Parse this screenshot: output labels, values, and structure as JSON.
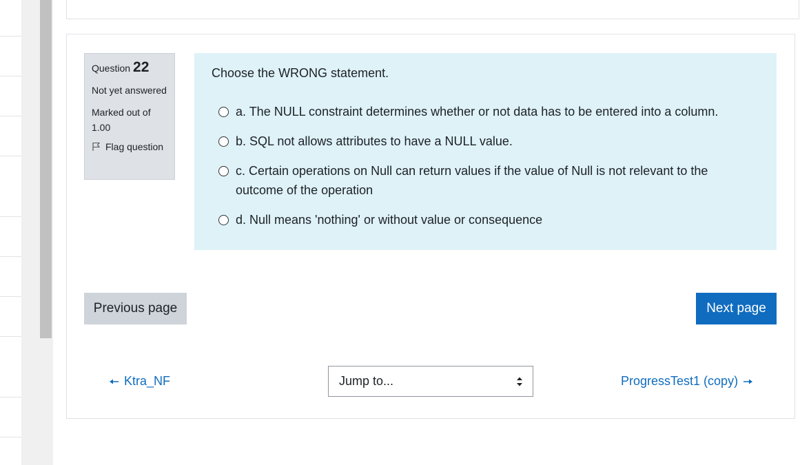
{
  "question": {
    "number_label": "Question",
    "number": "22",
    "state": "Not yet answered",
    "grade": "Marked out of 1.00",
    "flag_label": "Flag question",
    "text": "Choose the WRONG statement.",
    "answers": [
      {
        "label": "a. The NULL constraint determines whether or not data has to be entered into a column."
      },
      {
        "label": "b. SQL not allows attributes to have a NULL value."
      },
      {
        "label": "c. Certain operations on Null can return values if the value of Null is not relevant to the outcome of the operation"
      },
      {
        "label": "d. Null means 'nothing' or without value or consequence"
      }
    ]
  },
  "buttons": {
    "previous": "Previous page",
    "next": "Next page"
  },
  "activity_nav": {
    "previous_link": "Ktra_NF",
    "next_link": "ProgressTest1 (copy)",
    "jump_placeholder": "Jump to..."
  },
  "colors": {
    "accent": "#0f6cbf",
    "question_bg": "#def2f8",
    "info_bg": "#dee2e6"
  }
}
